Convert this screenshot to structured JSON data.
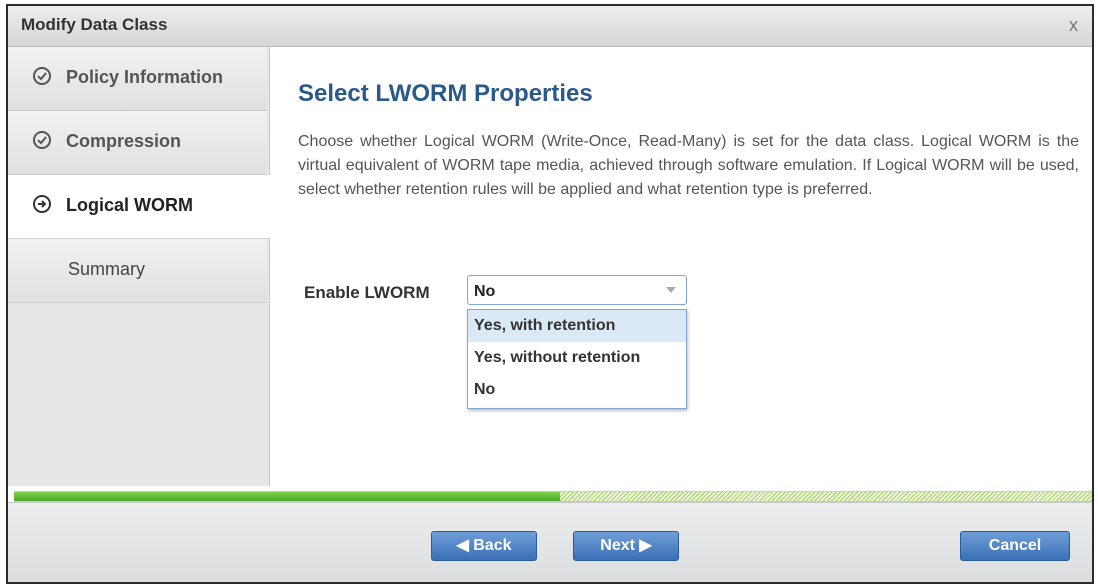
{
  "dialog": {
    "title": "Modify Data Class",
    "close_glyph": "x"
  },
  "sidebar": {
    "items": [
      {
        "label": "Policy Information",
        "icon": "check-circle-icon"
      },
      {
        "label": "Compression",
        "icon": "check-circle-icon"
      },
      {
        "label": "Logical WORM",
        "icon": "arrow-right-circle-icon",
        "active": true
      },
      {
        "label": "Summary"
      }
    ]
  },
  "main": {
    "heading": "Select LWORM Properties",
    "description": "Choose whether Logical WORM (Write-Once, Read-Many) is set for the data class. Logical WORM is the virtual equivalent of WORM tape media, achieved through software emulation. If Logical WORM will be used, select whether retention rules will be applied and what retention type is preferred.",
    "enable_label": "Enable LWORM",
    "select_value": "No",
    "options": [
      "Yes, with retention",
      "Yes, without retention",
      "No"
    ],
    "highlighted_option": "Yes, with retention"
  },
  "progress": {
    "fraction": 0.5
  },
  "footer": {
    "back": "◀ Back",
    "next": "Next ▶",
    "cancel": "Cancel"
  },
  "colors": {
    "heading": "#2a5a8a",
    "button": "#3a6fb5",
    "progress": "#4aa82a"
  }
}
